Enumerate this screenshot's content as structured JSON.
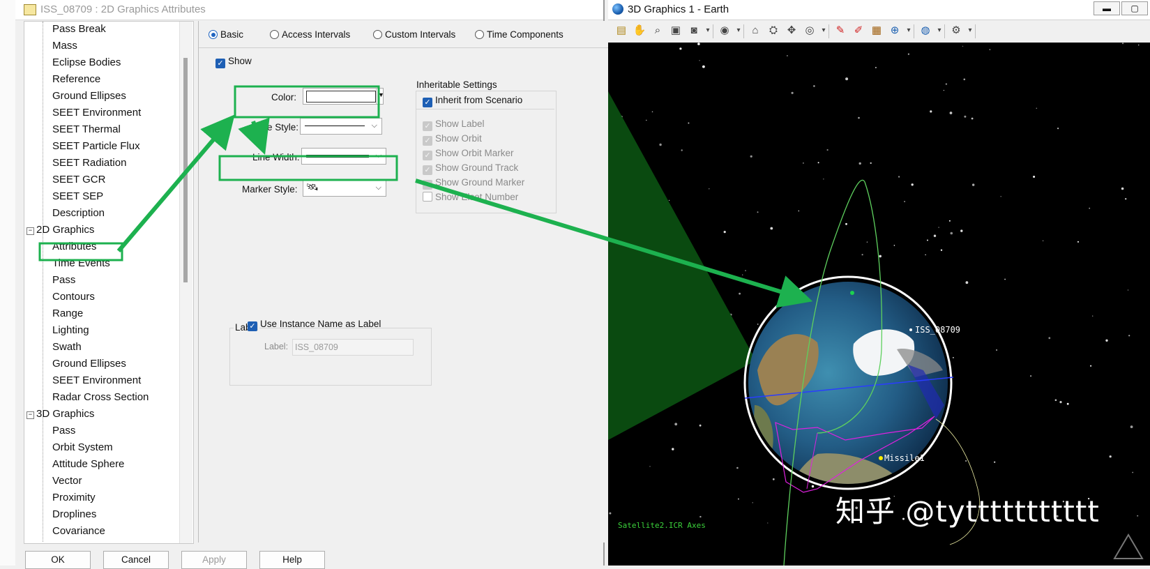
{
  "dialog": {
    "title": "ISS_08709 : 2D Graphics Attributes",
    "tree": {
      "items_top": [
        "Pass Break",
        "Mass",
        "Eclipse Bodies",
        "Reference",
        "Ground Ellipses",
        "SEET Environment",
        "SEET Thermal",
        "SEET Particle Flux",
        "SEET Radiation",
        "SEET GCR",
        "SEET SEP",
        "Description"
      ],
      "group_2d": "2D Graphics",
      "items_2d": [
        "Attributes",
        "Time Events",
        "Pass",
        "Contours",
        "Range",
        "Lighting",
        "Swath",
        "Ground Ellipses",
        "SEET Environment",
        "Radar Cross Section"
      ],
      "group_3d": "3D Graphics",
      "items_3d": [
        "Pass",
        "Orbit System",
        "Attitude Sphere",
        "Vector",
        "Proximity",
        "Droplines",
        "Covariance"
      ],
      "collapse_glyph": "−"
    },
    "tabs": [
      "Basic",
      "Access Intervals",
      "Custom Intervals",
      "Time Components"
    ],
    "show_label": "Show",
    "color_label": "Color:",
    "line_style_label": "Line Style:",
    "line_width_label": "Line Width:",
    "marker_style_label": "Marker Style:",
    "marker_glyph": "🛰",
    "inheritable": {
      "title": "Inheritable Settings",
      "inherit_label": "Inherit from Scenario",
      "options": [
        "Show Label",
        "Show Orbit",
        "Show Orbit Marker",
        "Show Ground Track",
        "Show Ground Marker",
        "Show Elset Number"
      ]
    },
    "label_group": {
      "title": "Label",
      "use_instance_label": "Use Instance Name as Label",
      "label_label": "Label:",
      "label_value": "ISS_08709"
    },
    "buttons": {
      "ok": "OK",
      "cancel": "Cancel",
      "apply": "Apply",
      "help": "Help"
    },
    "checkmark": "✓"
  },
  "window3d": {
    "title": "3D Graphics 1 - Earth",
    "min_glyph": "▬",
    "max_glyph": "▢",
    "toolbar_icons": [
      "notes-icon",
      "pan-hand-icon",
      "zoom-icon",
      "view-from-icon",
      "snapshot-icon",
      "dropdown-icon",
      "eye-icon",
      "dropdown-icon",
      "home-view-icon",
      "view-object-icon",
      "orient-icon",
      "binoculars-icon",
      "dropdown-icon",
      "pencil-icon",
      "measure-icon",
      "ruler-icon",
      "globe-grid-icon",
      "dropdown-icon",
      "earth-icon",
      "dropdown-icon",
      "settings-icon",
      "dropdown-icon"
    ],
    "objects": {
      "satellite": "ISS_08709",
      "missile": "Missile1"
    },
    "axes_label": "Satellite2.ICR Axes",
    "watermark": "知乎 @tyttttttttttt",
    "colors": {
      "highlight": "#1db14f",
      "orbit": "#5ed05e",
      "ground_track": "#e020e0",
      "equator": "#2a3cff"
    }
  }
}
